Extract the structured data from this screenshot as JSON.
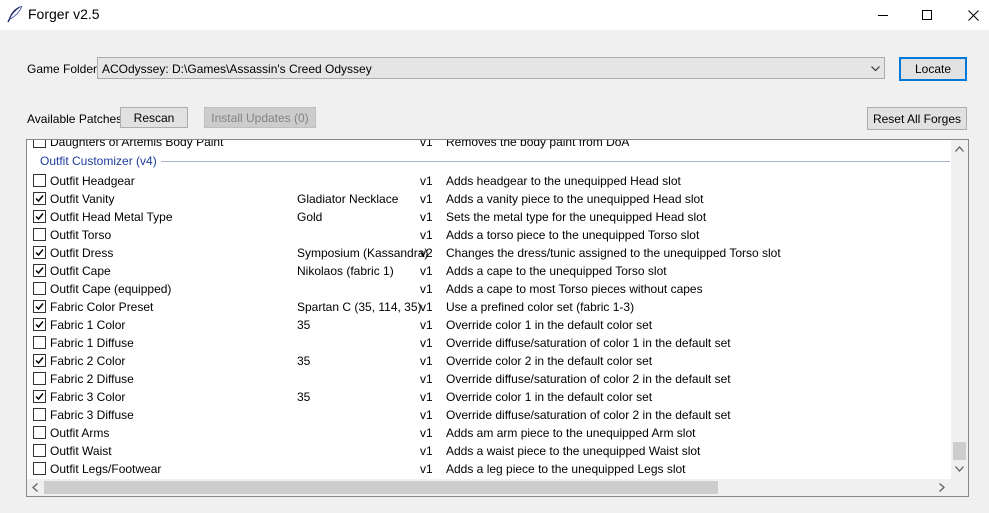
{
  "window": {
    "title": "Forger v2.5"
  },
  "game_folder": {
    "label": "Game Folder",
    "value": "ACOdyssey: D:\\Games\\Assassin's Creed Odyssey",
    "locate_label": "Locate"
  },
  "patches": {
    "label": "Available Patches",
    "rescan_label": "Rescan",
    "install_label": "Install Updates (0)",
    "reset_label": "Reset All Forges"
  },
  "list": {
    "partial_row": {
      "name": "Daughters of Artemis Body Paint",
      "version": "v1",
      "description": "Removes the body paint from DoA"
    },
    "group_title": "Outfit Customizer (v4)",
    "rows": [
      {
        "checked": false,
        "name": "Outfit Headgear",
        "value": "",
        "version": "v1",
        "description": "Adds headgear to the unequipped Head slot"
      },
      {
        "checked": true,
        "name": "Outfit Vanity",
        "value": "Gladiator Necklace",
        "version": "v1",
        "description": "Adds a vanity piece to the unequipped Head slot"
      },
      {
        "checked": true,
        "name": "Outfit Head Metal Type",
        "value": "Gold",
        "version": "v1",
        "description": "Sets the metal type for the unequipped Head slot"
      },
      {
        "checked": false,
        "name": "Outfit Torso",
        "value": "",
        "version": "v1",
        "description": "Adds a torso piece to the unequipped Torso slot"
      },
      {
        "checked": true,
        "name": "Outfit Dress",
        "value": "Symposium (Kassandra)",
        "version": "v2",
        "description": "Changes the dress/tunic assigned to the unequipped Torso slot"
      },
      {
        "checked": true,
        "name": "Outfit Cape",
        "value": "Nikolaos (fabric 1)",
        "version": "v1",
        "description": "Adds a cape to the unequipped Torso slot"
      },
      {
        "checked": false,
        "name": "Outfit Cape (equipped)",
        "value": "",
        "version": "v1",
        "description": "Adds a cape to most Torso pieces without capes"
      },
      {
        "checked": true,
        "name": "Fabric Color Preset",
        "value": "Spartan C (35, 114, 35)",
        "version": "v1",
        "description": "Use a prefined color set (fabric 1-3)"
      },
      {
        "checked": true,
        "name": "Fabric 1 Color",
        "value": "35",
        "version": "v1",
        "description": "Override color 1 in the default color set"
      },
      {
        "checked": false,
        "name": "Fabric 1 Diffuse",
        "value": "",
        "version": "v1",
        "description": "Override diffuse/saturation of color 1 in the default set"
      },
      {
        "checked": true,
        "name": "Fabric 2 Color",
        "value": "35",
        "version": "v1",
        "description": "Override color 2 in the default color set"
      },
      {
        "checked": false,
        "name": "Fabric 2 Diffuse",
        "value": "",
        "version": "v1",
        "description": "Override diffuse/saturation of color 2 in the default set"
      },
      {
        "checked": true,
        "name": "Fabric 3 Color",
        "value": "35",
        "version": "v1",
        "description": "Override color 1 in the default color set"
      },
      {
        "checked": false,
        "name": "Fabric 3 Diffuse",
        "value": "",
        "version": "v1",
        "description": "Override diffuse/saturation of color 2 in the default set"
      },
      {
        "checked": false,
        "name": "Outfit Arms",
        "value": "",
        "version": "v1",
        "description": "Adds am arm piece to the unequipped Arm slot"
      },
      {
        "checked": false,
        "name": "Outfit Waist",
        "value": "",
        "version": "v1",
        "description": "Adds a waist piece to the unequipped Waist slot"
      },
      {
        "checked": false,
        "name": "Outfit Legs/Footwear",
        "value": "",
        "version": "v1",
        "description": "Adds a leg piece to the unequipped Legs slot"
      }
    ]
  },
  "colors": {
    "accent": "#0078d7",
    "group_title": "#1e3c9c",
    "window_bg": "#f0f0f0"
  },
  "icons": {
    "app": "quill-feather-icon",
    "dropdown": "chevron-down-icon"
  }
}
